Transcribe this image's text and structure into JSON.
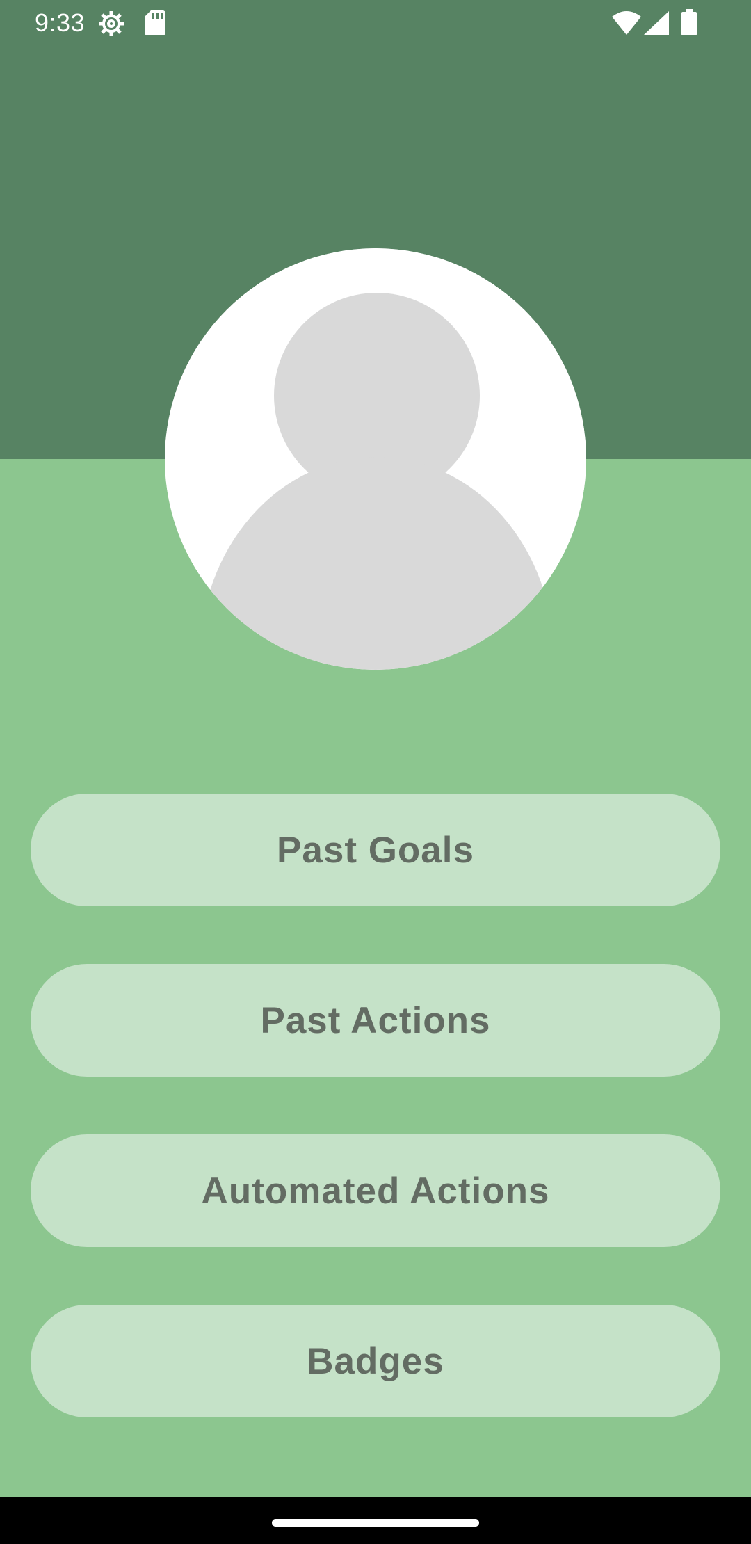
{
  "status_bar": {
    "time": "9:33",
    "icons": [
      "settings-gear-icon",
      "sd-card-icon",
      "wifi-icon",
      "cellular-signal-icon",
      "battery-icon"
    ]
  },
  "profile": {
    "avatar_icon": "default-person-avatar-icon"
  },
  "menu": {
    "past_goals_label": "Past Goals",
    "past_actions_label": "Past Actions",
    "automated_actions_label": "Automated Actions",
    "badges_label": "Badges"
  },
  "colors": {
    "header": "#578363",
    "background": "#8cc68f",
    "button_fill": "#c5e2c8",
    "button_text": "#636c63",
    "avatar_fill": "#d9d9d9"
  }
}
